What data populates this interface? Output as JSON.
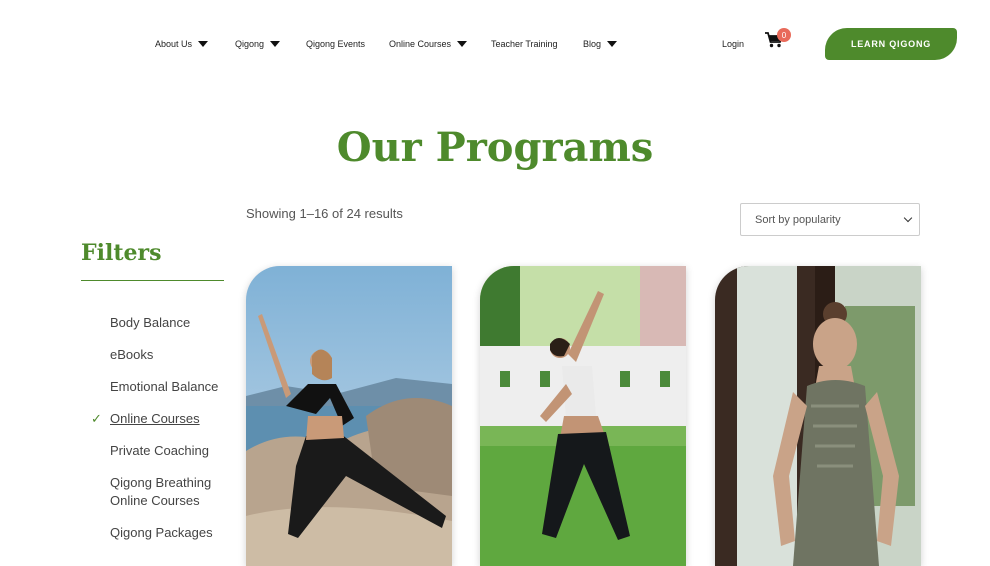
{
  "nav": {
    "items": [
      {
        "label": "About Us",
        "caret": true
      },
      {
        "label": "Qigong",
        "caret": true
      },
      {
        "label": "Qigong Events",
        "caret": false
      },
      {
        "label": "Online Courses",
        "caret": true
      },
      {
        "label": "Teacher Training",
        "caret": false
      },
      {
        "label": "Blog",
        "caret": true
      }
    ],
    "login": "Login",
    "cart_count": "0",
    "cta": "LEARN QIGONG"
  },
  "page": {
    "title": "Our Programs",
    "results": "Showing 1–16 of 24 results",
    "sort_selected": "Sort by popularity"
  },
  "filters": {
    "title": "Filters",
    "items": [
      {
        "label": "Body Balance",
        "active": false
      },
      {
        "label": "eBooks",
        "active": false
      },
      {
        "label": "Emotional Balance",
        "active": false
      },
      {
        "label": "Online Courses",
        "active": true
      },
      {
        "label": "Private Coaching",
        "active": false
      },
      {
        "label": "Qigong Breathing Online Courses",
        "active": false
      },
      {
        "label": "Qigong Packages",
        "active": false
      }
    ],
    "check": "✓"
  },
  "products": [
    {
      "image": "woman-lunge-on-rocks-by-sea"
    },
    {
      "image": "woman-wide-stance-in-garden"
    },
    {
      "image": "woman-meditating-indoors"
    }
  ],
  "colors": {
    "brand": "#4e8a2c",
    "badge": "#e86a5a"
  }
}
